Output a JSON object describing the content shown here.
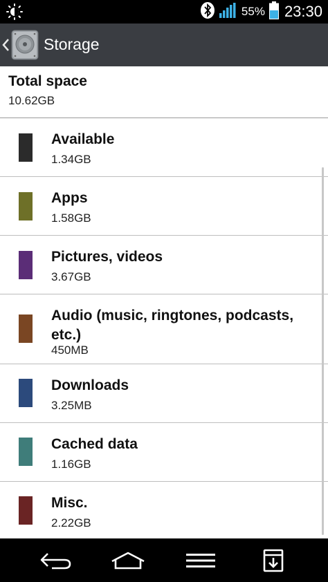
{
  "status_bar": {
    "battery_percent": "55%",
    "time": "23:30",
    "icons": [
      "brightness-icon",
      "bluetooth-icon",
      "signal-icon",
      "battery-icon"
    ]
  },
  "action_bar": {
    "title": "Storage",
    "icons": [
      "back-chevron-icon",
      "storage-app-icon"
    ]
  },
  "total": {
    "label": "Total space",
    "value": "10.62GB"
  },
  "items": [
    {
      "label": "Available",
      "value": "1.34GB",
      "color": "#2b2b2b"
    },
    {
      "label": "Apps",
      "value": "1.58GB",
      "color": "#6e7028"
    },
    {
      "label": "Pictures, videos",
      "value": "3.67GB",
      "color": "#5b2d77"
    },
    {
      "label": "Audio (music, ringtones, podcasts, etc.)",
      "value": "450MB",
      "color": "#7a4623"
    },
    {
      "label": "Downloads",
      "value": "3.25MB",
      "color": "#2c4a7c"
    },
    {
      "label": "Cached data",
      "value": "1.16GB",
      "color": "#3f7d7a"
    },
    {
      "label": "Misc.",
      "value": "2.22GB",
      "color": "#6a2424"
    }
  ],
  "nav_bar": {
    "icons": [
      "back-icon",
      "home-icon",
      "menu-icon",
      "notification-drawer-icon"
    ]
  }
}
